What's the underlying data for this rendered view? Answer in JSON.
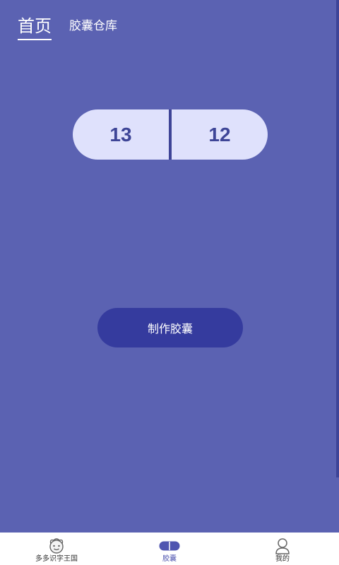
{
  "header": {
    "tabs": [
      {
        "label": "首页",
        "active": true
      },
      {
        "label": "胶囊仓库",
        "active": false
      }
    ]
  },
  "counter": {
    "left_value": "13",
    "right_value": "12"
  },
  "actions": {
    "make_capsule_label": "制作胶囊"
  },
  "bottom_nav": {
    "items": [
      {
        "label": "多多识字王国",
        "icon": "face-icon",
        "active": false
      },
      {
        "label": "胶囊",
        "icon": "capsule-icon",
        "active": true
      },
      {
        "label": "我的",
        "icon": "user-icon",
        "active": false
      }
    ]
  },
  "colors": {
    "background": "#5b62b2",
    "pill": "#dfe1fc",
    "button": "#353b9e",
    "accent": "#4f55b0"
  }
}
